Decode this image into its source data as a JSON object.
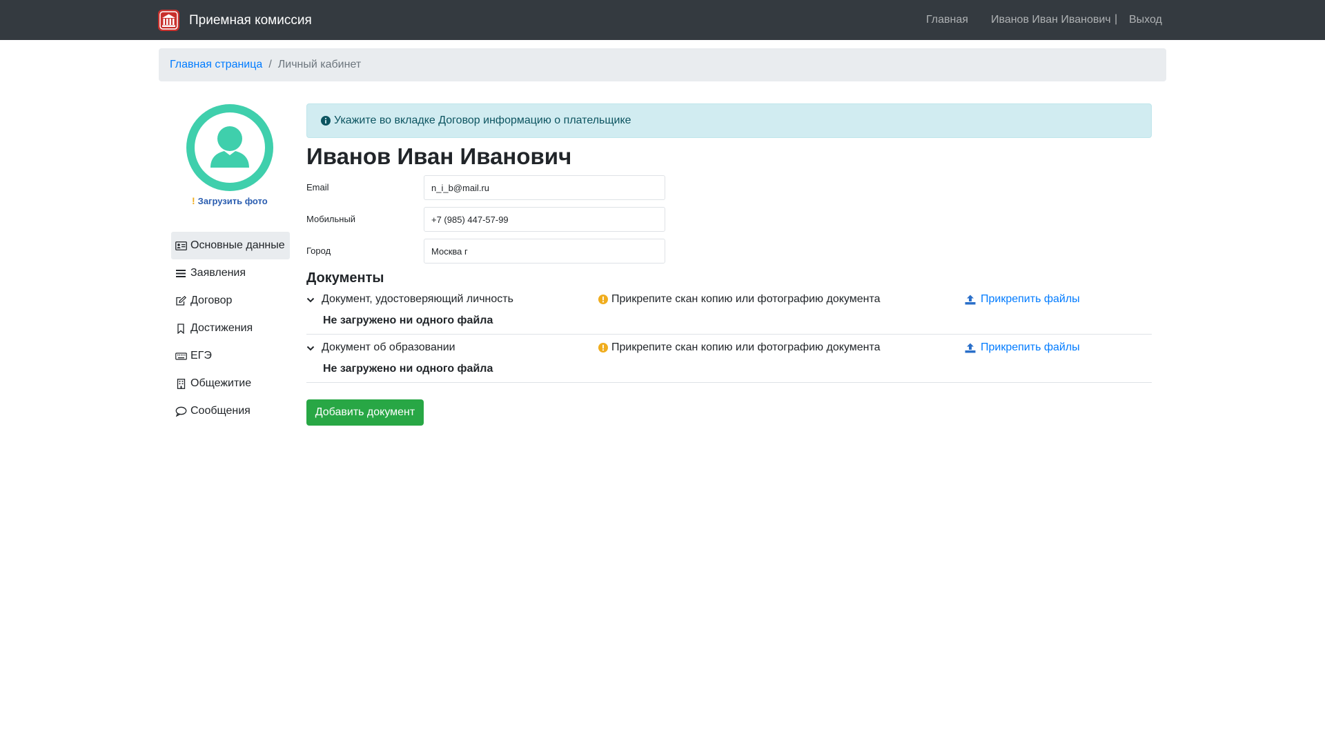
{
  "navbar": {
    "brand": "Приемная комиссия",
    "home_link": "Главная",
    "user_link": "Иванов Иван Иванович",
    "separator": "|",
    "logout_link": "Выход"
  },
  "breadcrumb": {
    "home": "Главная страница",
    "separator": "/",
    "current": "Личный кабинет"
  },
  "profile": {
    "upload_photo_mark": "!",
    "upload_photo": "Загрузить фото"
  },
  "sidebar": {
    "items": [
      {
        "label": "Основные данные",
        "icon": "id-card-icon"
      },
      {
        "label": "Заявления",
        "icon": "list-icon"
      },
      {
        "label": "Договор",
        "icon": "edit-icon"
      },
      {
        "label": "Достижения",
        "icon": "bookmark-icon"
      },
      {
        "label": "ЕГЭ",
        "icon": "keyboard-icon"
      },
      {
        "label": "Общежитие",
        "icon": "building-icon"
      },
      {
        "label": "Сообщения",
        "icon": "comment-icon"
      }
    ]
  },
  "alert": {
    "text": "Укажите во вкладке Договор информацию о плательщике"
  },
  "person": {
    "name": "Иванов Иван Иванович"
  },
  "fields": {
    "email": {
      "label": "Email",
      "value": "n_i_b@mail.ru"
    },
    "phone": {
      "label": "Мобильный",
      "value": "+7 (985) 447-57-99"
    },
    "city": {
      "label": "Город",
      "value": "Москва г"
    }
  },
  "documents": {
    "title": "Документы",
    "items": [
      {
        "title": "Документ, удостоверяющий личность",
        "warning": "Прикрепите скан копию или фотографию документа",
        "attach": "Прикрепить файлы",
        "status": "Не загружено ни одного файла"
      },
      {
        "title": "Документ об образовании",
        "warning": "Прикрепите скан копию или фотографию документа",
        "attach": "Прикрепить файлы",
        "status": "Не загружено ни одного файла"
      }
    ],
    "add_button": "Добавить документ"
  },
  "colors": {
    "navbar_bg": "#343a40",
    "link": "#007bff",
    "success": "#28a745",
    "avatar": "#3fcfac",
    "warning": "#f0ad1e",
    "info_bg": "#d1ecf1"
  }
}
